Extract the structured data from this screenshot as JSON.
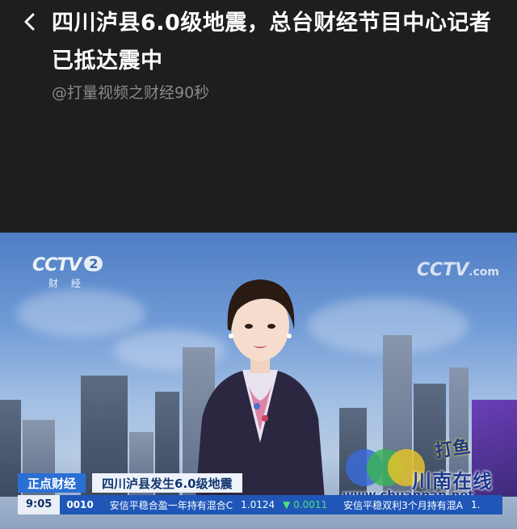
{
  "header": {
    "title": "四川泸县6.0级地震，总台财经节目中心记者已抵达震中",
    "source": "@打量视频之财经90秒"
  },
  "video": {
    "channel_logo": "CCTV",
    "channel_number": "2",
    "channel_name": "财 经",
    "corner_logo": "CCTV",
    "corner_logo_suffix": ".com",
    "lower_third": {
      "show_name": "正点财经",
      "headline": "四川泸县发生6.0级地震"
    },
    "ticker": {
      "time": "9:05",
      "code": "0010",
      "fund_name": "安信平稳合盈一年持有混合C",
      "value": "1.0124",
      "change": "▼ 0.0011",
      "fund_name_2": "安信平稳双利3个月持有混A",
      "value_2": "1."
    },
    "watermark": {
      "site_name": "川南在线",
      "url": "www.chuannan.net",
      "badge": "打鱼"
    }
  },
  "colors": {
    "background": "#1e1e1e",
    "title": "#ffffff",
    "source": "#8a8a8a",
    "show_name_bg": "#2a6fd4",
    "ticker_bg": "#1f56b8",
    "ticker_down": "#4de07a"
  },
  "icons": {
    "back": "chevron-left-icon"
  }
}
